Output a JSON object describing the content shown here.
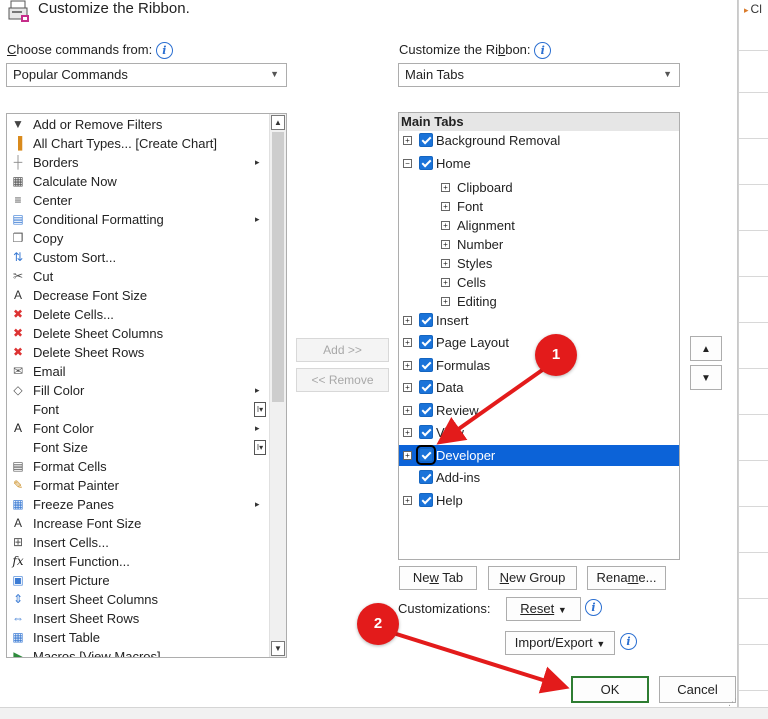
{
  "excel": {
    "cell_ref": "Cl"
  },
  "dialog": {
    "title": "Customize the Ribbon.",
    "choose_label_pre": "C",
    "choose_label_post": "hoose commands from:",
    "choose_value": "Popular Commands",
    "customize_label_pre": "Customize the Ri",
    "customize_label_u": "b",
    "customize_label_post": "bon:",
    "customize_value": "Main Tabs"
  },
  "commands": [
    {
      "label": "Add or Remove Filters",
      "icon": "filter-icon",
      "glyph": "▼",
      "sub": ""
    },
    {
      "label": "All Chart Types... [Create Chart]",
      "icon": "chart-icon",
      "glyph": "▐",
      "sub": ""
    },
    {
      "label": "Borders",
      "icon": "borders-icon",
      "glyph": "┼",
      "sub": "▸"
    },
    {
      "label": "Calculate Now",
      "icon": "calculator-icon",
      "glyph": "▦",
      "sub": ""
    },
    {
      "label": "Center",
      "icon": "center-align-icon",
      "glyph": "≡",
      "sub": ""
    },
    {
      "label": "Conditional Formatting",
      "icon": "conditional-formatting-icon",
      "glyph": "▤",
      "sub": "▸"
    },
    {
      "label": "Copy",
      "icon": "copy-icon",
      "glyph": "❐",
      "sub": ""
    },
    {
      "label": "Custom Sort...",
      "icon": "sort-icon",
      "glyph": "⇅",
      "sub": ""
    },
    {
      "label": "Cut",
      "icon": "scissors-icon",
      "glyph": "✂",
      "sub": ""
    },
    {
      "label": "Decrease Font Size",
      "icon": "decrease-font-icon",
      "glyph": "A",
      "sub": ""
    },
    {
      "label": "Delete Cells...",
      "icon": "delete-cells-icon",
      "glyph": "✖",
      "sub": ""
    },
    {
      "label": "Delete Sheet Columns",
      "icon": "delete-columns-icon",
      "glyph": "✖",
      "sub": ""
    },
    {
      "label": "Delete Sheet Rows",
      "icon": "delete-rows-icon",
      "glyph": "✖",
      "sub": ""
    },
    {
      "label": "Email",
      "icon": "email-icon",
      "glyph": "✉",
      "sub": ""
    },
    {
      "label": "Fill Color",
      "icon": "fill-color-icon",
      "glyph": "◇",
      "sub": "▸"
    },
    {
      "label": "Font",
      "icon": "",
      "glyph": "",
      "sub": "I▾"
    },
    {
      "label": "Font Color",
      "icon": "font-color-icon",
      "glyph": "A",
      "sub": "▸"
    },
    {
      "label": "Font Size",
      "icon": "",
      "glyph": "",
      "sub": "I▾"
    },
    {
      "label": "Format Cells",
      "icon": "format-cells-icon",
      "glyph": "▤",
      "sub": ""
    },
    {
      "label": "Format Painter",
      "icon": "format-painter-icon",
      "glyph": "✎",
      "sub": ""
    },
    {
      "label": "Freeze Panes",
      "icon": "freeze-panes-icon",
      "glyph": "▦",
      "sub": "▸"
    },
    {
      "label": "Increase Font Size",
      "icon": "increase-font-icon",
      "glyph": "A",
      "sub": ""
    },
    {
      "label": "Insert Cells...",
      "icon": "insert-cells-icon",
      "glyph": "⊞",
      "sub": ""
    },
    {
      "label": "Insert Function...",
      "icon": "function-icon",
      "glyph": "fx",
      "sub": ""
    },
    {
      "label": "Insert Picture",
      "icon": "picture-icon",
      "glyph": "▣",
      "sub": ""
    },
    {
      "label": "Insert Sheet Columns",
      "icon": "insert-columns-icon",
      "glyph": "⇕",
      "sub": ""
    },
    {
      "label": "Insert Sheet Rows",
      "icon": "insert-rows-icon",
      "glyph": "⇔",
      "sub": ""
    },
    {
      "label": "Insert Table",
      "icon": "table-icon",
      "glyph": "▦",
      "sub": ""
    },
    {
      "label": "Macros [View Macros]",
      "icon": "macros-icon",
      "glyph": "▶",
      "sub": ""
    }
  ],
  "add_button": "Add >>",
  "remove_button": "<< Remove",
  "tree": {
    "header": "Main Tabs",
    "items": [
      {
        "label": "Background Removal",
        "level": 0,
        "expander": "+",
        "checkbox": true
      },
      {
        "label": "Home",
        "level": 0,
        "expander": "−",
        "checkbox": true
      },
      {
        "label": "Clipboard",
        "level": 1,
        "expander": "+",
        "checkbox": false
      },
      {
        "label": "Font",
        "level": 1,
        "expander": "+",
        "checkbox": false
      },
      {
        "label": "Alignment",
        "level": 1,
        "expander": "+",
        "checkbox": false
      },
      {
        "label": "Number",
        "level": 1,
        "expander": "+",
        "checkbox": false
      },
      {
        "label": "Styles",
        "level": 1,
        "expander": "+",
        "checkbox": false
      },
      {
        "label": "Cells",
        "level": 1,
        "expander": "+",
        "checkbox": false
      },
      {
        "label": "Editing",
        "level": 1,
        "expander": "+",
        "checkbox": false
      },
      {
        "label": "Insert",
        "level": 0,
        "expander": "+",
        "checkbox": true
      },
      {
        "label": "Page Layout",
        "level": 0,
        "expander": "+",
        "checkbox": true
      },
      {
        "label": "Formulas",
        "level": 0,
        "expander": "+",
        "checkbox": true
      },
      {
        "label": "Data",
        "level": 0,
        "expander": "+",
        "checkbox": true
      },
      {
        "label": "Review",
        "level": 0,
        "expander": "+",
        "checkbox": true
      },
      {
        "label": "View",
        "level": 0,
        "expander": "+",
        "checkbox": true
      },
      {
        "label": "Developer",
        "level": 0,
        "expander": "+",
        "checkbox": true,
        "selected": true
      },
      {
        "label": "Add-ins",
        "level": 0,
        "expander": "",
        "checkbox": true
      },
      {
        "label": "Help",
        "level": 0,
        "expander": "+",
        "checkbox": true
      }
    ]
  },
  "buttons": {
    "new_tab_pre": "Ne",
    "new_tab_u": "w",
    "new_tab_post": " Tab",
    "new_group_pre": "",
    "new_group_u": "N",
    "new_group_post": "ew Group",
    "rename_pre": "Rena",
    "rename_u": "m",
    "rename_post": "e...",
    "reset": "Reset",
    "import_export": "Import/Export",
    "ok": "OK",
    "cancel": "Cancel"
  },
  "customizations_label": "Customizations:",
  "annotations": {
    "badge1": "1",
    "badge2": "2"
  },
  "colors": {
    "accent": "#1a73d9",
    "selection": "#0c63d8",
    "annotation": "#e31b1b"
  }
}
